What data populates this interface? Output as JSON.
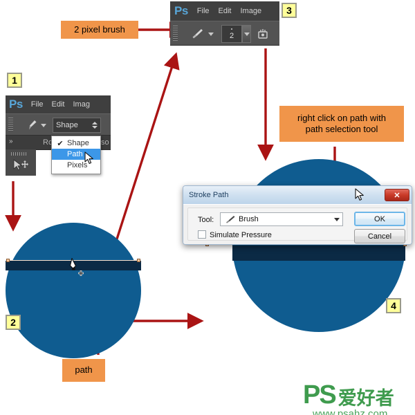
{
  "callouts": {
    "brush": "2 pixel brush",
    "rightclick": "right click on path with\npath selection tool",
    "path": "path"
  },
  "steps": {
    "one": "1",
    "two": "2",
    "three": "3",
    "four": "4"
  },
  "toolbar_top": {
    "logo": "Ps",
    "menu": [
      "File",
      "Edit",
      "Image"
    ],
    "brush_size": "2",
    "brush_icon": "brush-icon",
    "airbrush_icon": "airbrush-icon",
    "preset_caret_icon": "chevron-down-icon"
  },
  "toolbar_left": {
    "logo": "Ps",
    "menu": [
      "File",
      "Edit",
      "Imag"
    ],
    "pen_icon": "pen-tool-icon",
    "mode_value": "Shape",
    "panel_expand_icon": "double-chevron-right-icon",
    "panel_label": "Ro",
    "panel_label_right": "so",
    "path_select_icon": "path-selection-tool-icon",
    "dropdown": {
      "items": [
        {
          "label": "Shape",
          "checked": true,
          "selected": false
        },
        {
          "label": "Path",
          "checked": false,
          "selected": true
        },
        {
          "label": "Pixels",
          "checked": false,
          "selected": false
        }
      ],
      "check_glyph": "✔",
      "cursor_icon": "mouse-pointer-icon"
    }
  },
  "dialog": {
    "title": "Stroke Path",
    "close_glyph": "✕",
    "tool_label": "Tool:",
    "tool_value": "Brush",
    "tool_icon": "brush-icon",
    "simulate_label": "Simulate Pressure",
    "simulate_checked": false,
    "ok_label": "OK",
    "cancel_label": "Cancel",
    "cursor_icon": "mouse-pointer-icon"
  },
  "canvas": {
    "circle_color": "#0f5c90",
    "path_band_color": "#0b2a45",
    "path_anchor_color": "#f6c9a0",
    "pen_cursor_icon": "pen-cursor-icon"
  },
  "arrow_color": "#aa1414",
  "watermark": {
    "ps": "PS",
    "cn": "爱好者",
    "url": "www.psahz.com"
  }
}
